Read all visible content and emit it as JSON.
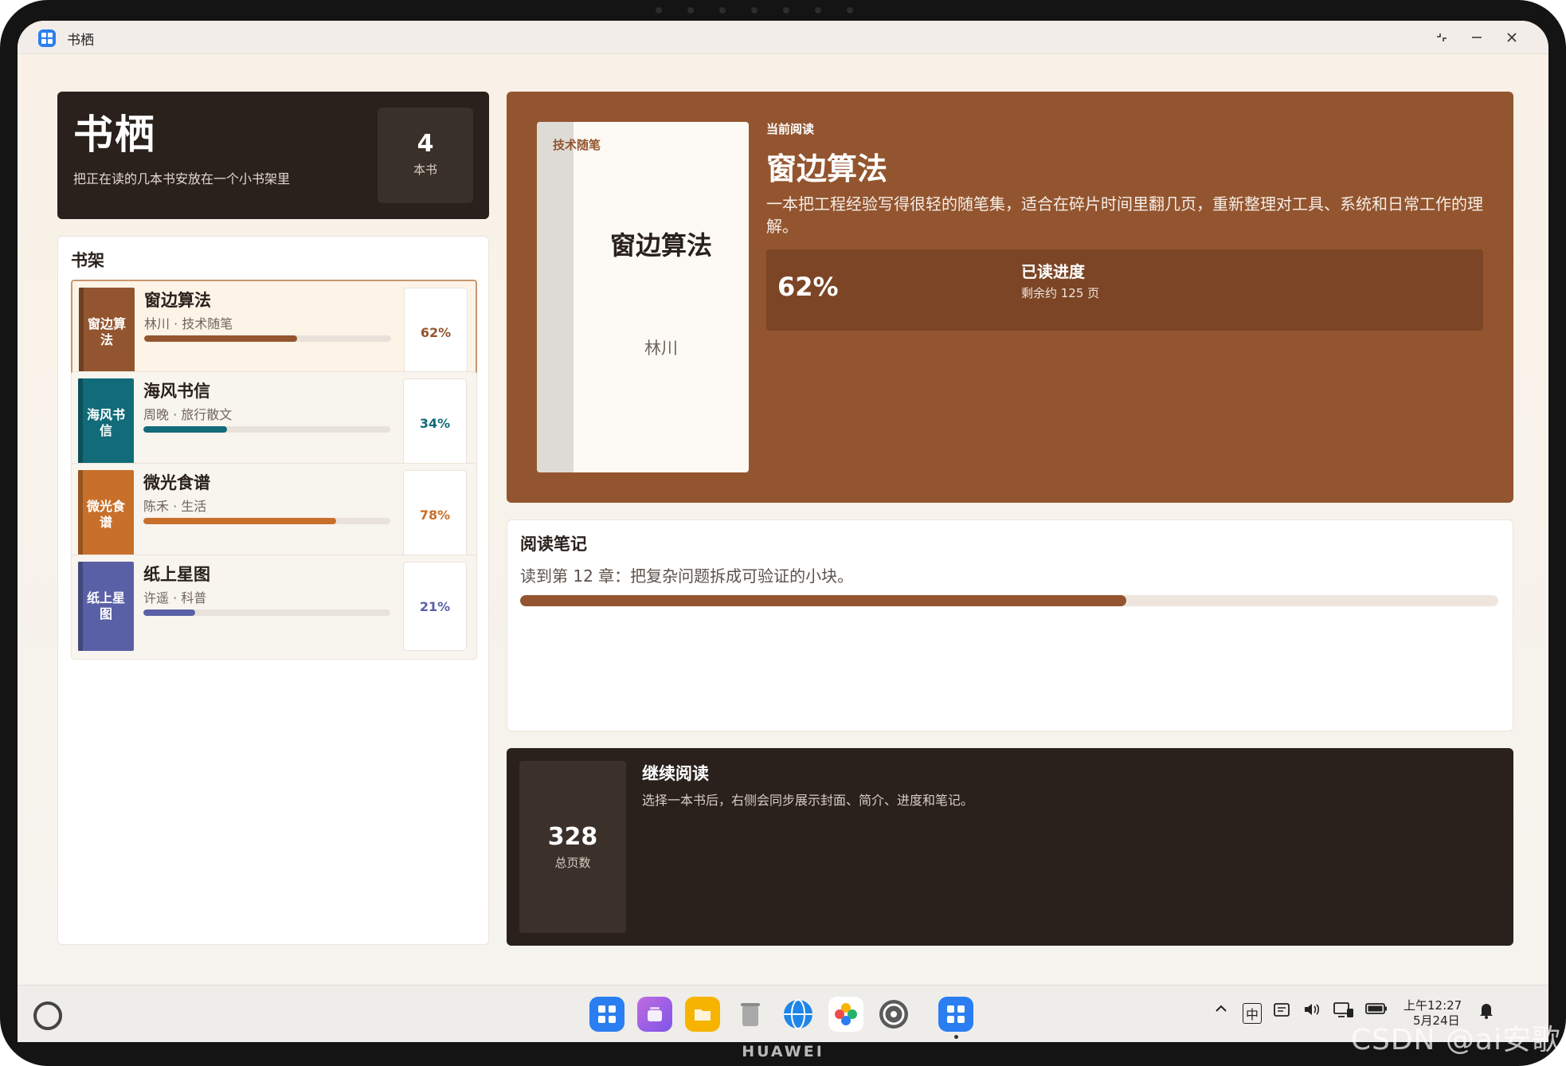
{
  "window": {
    "title": "书栖"
  },
  "hero": {
    "title": "书栖",
    "subtitle": "把正在读的几本书安放在一个小书架里",
    "count": "4",
    "count_label": "本书"
  },
  "shelf": {
    "heading": "书架",
    "books": [
      {
        "spine": "窗边算法",
        "title": "窗边算法",
        "meta": "林川 · 技术随笔",
        "percent": "62%",
        "progress": 0.62,
        "color": "#93552f",
        "pct_color": "#93552f"
      },
      {
        "spine": "海风书信",
        "title": "海风书信",
        "meta": "周晚 · 旅行散文",
        "percent": "34%",
        "progress": 0.34,
        "color": "#116b78",
        "pct_color": "#116b78"
      },
      {
        "spine": "微光食谱",
        "title": "微光食谱",
        "meta": "陈禾 · 生活",
        "percent": "78%",
        "progress": 0.78,
        "color": "#c8702b",
        "pct_color": "#c8702b"
      },
      {
        "spine": "纸上星图",
        "title": "纸上星图",
        "meta": "许遥 · 科普",
        "percent": "21%",
        "progress": 0.21,
        "color": "#5a60a6",
        "pct_color": "#5a60a6"
      }
    ]
  },
  "current": {
    "label": "当前阅读",
    "title": "窗边算法",
    "cover_tag": "技术随笔",
    "cover_title": "窗边算法",
    "author": "林川",
    "description": "一本把工程经验写得很轻的随笔集，适合在碎片时间里翻几页，重新整理对工具、系统和日常工作的理解。",
    "percent": "62%",
    "progress_label": "已读进度",
    "remaining": "剩余约 125 页"
  },
  "notes": {
    "title": "阅读笔记",
    "text": "读到第 12 章：把复杂问题拆成可验证的小块。",
    "progress": 0.62
  },
  "continue": {
    "title": "继续阅读",
    "description": "选择一本书后，右侧会同步展示封面、简介、进度和笔记。",
    "total": "328",
    "total_label": "总页数"
  },
  "taskbar": {
    "time": "上午12:27",
    "date": "5月24日",
    "input_method": "中",
    "apps": [
      "app-grid-icon",
      "multitask-icon",
      "files-icon",
      "trash-icon",
      "browser-icon",
      "photos-icon",
      "settings-icon",
      "shuqi-app-icon"
    ]
  },
  "brand": "HUAWEI",
  "watermark": "CSDN @ai安歌",
  "colors": {
    "accent": "#93552f",
    "dark": "#2a211c",
    "teal": "#116b78",
    "orange": "#c8702b",
    "indigo": "#5a60a6"
  }
}
